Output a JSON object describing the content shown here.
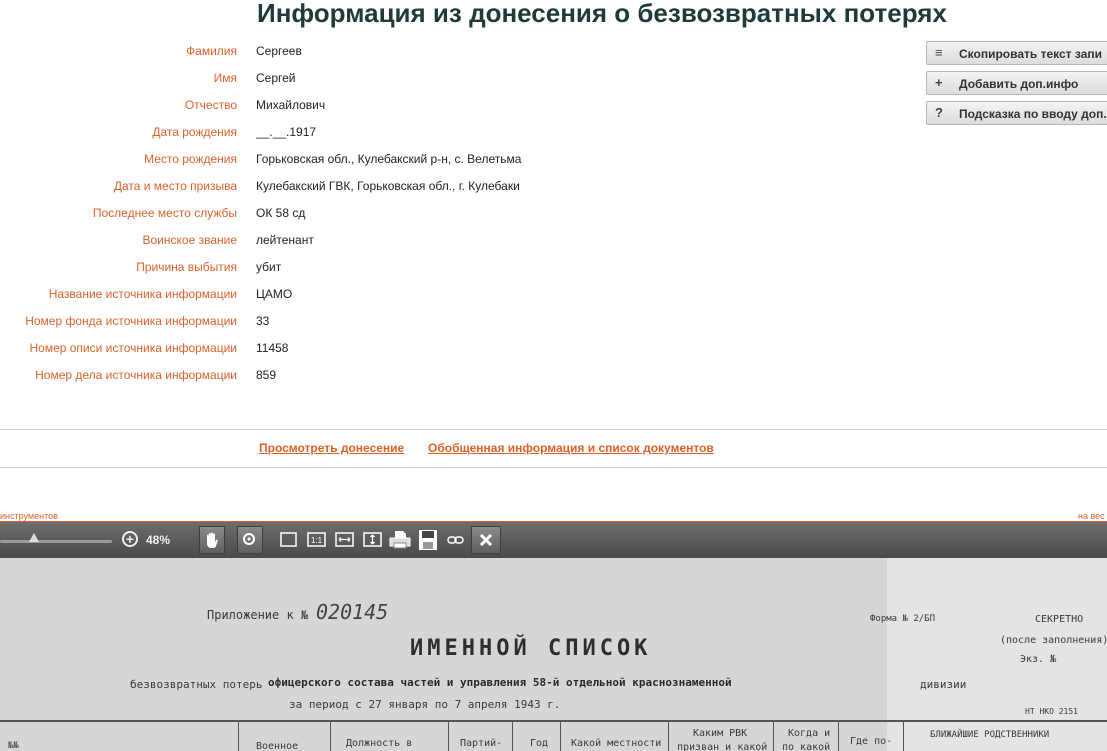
{
  "page_title": "Информация из донесения о безвозвратных потерях",
  "fields": [
    {
      "label": "Фамилия",
      "value": "Сергеев"
    },
    {
      "label": "Имя",
      "value": "Сергей"
    },
    {
      "label": "Отчество",
      "value": "Михайлович"
    },
    {
      "label": "Дата рождения",
      "value": "__.__.1917"
    },
    {
      "label": "Место рождения",
      "value": "Горьковская обл., Кулебакский р-н, с. Велетьма"
    },
    {
      "label": "Дата и место призыва",
      "value": "Кулебакский ГВК, Горьковская обл., г. Кулебаки"
    },
    {
      "label": "Последнее место службы",
      "value": "ОК 58 сд"
    },
    {
      "label": "Воинское звание",
      "value": "лейтенант"
    },
    {
      "label": "Причина выбытия",
      "value": "убит"
    },
    {
      "label": "Название источника информации",
      "value": "ЦАМО"
    },
    {
      "label": "Номер фонда источника информации",
      "value": "33"
    },
    {
      "label": "Номер описи источника информации",
      "value": "11458"
    },
    {
      "label": "Номер дела источника информации",
      "value": "859"
    }
  ],
  "side_buttons": [
    {
      "icon": "≡",
      "label": "Скопировать текст запи"
    },
    {
      "icon": "+",
      "label": "Добавить доп.инфо"
    },
    {
      "icon": "?",
      "label": "Подсказка по вводу доп."
    }
  ],
  "links": {
    "view_report": "Просмотреть донесение",
    "summary": "Обобщенная информация и список документов"
  },
  "viewer": {
    "tools_label_left": "инструментов",
    "tools_label_right": "на вес",
    "zoom_level": "48%",
    "zoom_fraction": 0.3
  },
  "document_scan": {
    "title": "ИМЕННОЙ СПИСОК",
    "prilozhenie": "Приложение к №",
    "prilozhenie_num": "020145",
    "forma": "Форма № 2/БП",
    "secret": "СЕКРЕТНО",
    "posle": "(после заполнения)",
    "ekz": "Экз. №",
    "line1_left": "безвозвратных потерь",
    "line1_mid": "офицерского состава частей и управления 58-й отдельной краснознаменной",
    "line1_right": "дивизии",
    "period": "за период с  27 января        по  7 апреля       1943 г.",
    "nko": "НТ НКО 2151",
    "col_no": "№№",
    "col_voen": "Военное",
    "col_dolzh": "Должность в",
    "col_part": "Партий-",
    "col_god": "Год",
    "col_kakoy": "Какой местности",
    "col_rvk": "Каким РВК",
    "col_rvk2": "призван и какой",
    "col_kogda": "Когда и",
    "col_kogda2": "по какой",
    "col_gde": "Где по-",
    "col_rodstv": "БЛИЖАЙШИЕ РОДСТВЕННИКИ"
  }
}
